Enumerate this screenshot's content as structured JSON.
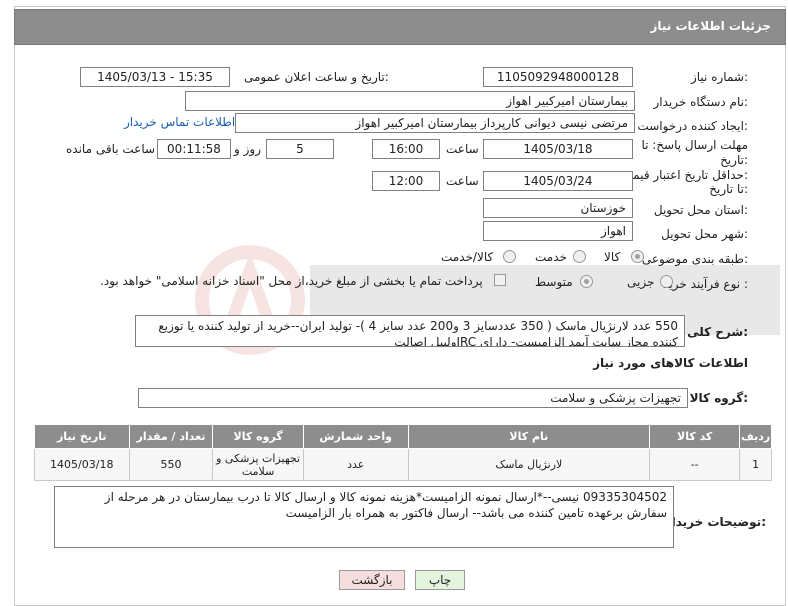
{
  "header": {
    "title": "جزئیات اطلاعات نیاز"
  },
  "fields": {
    "need_number_label": "شماره نیاز:",
    "need_number": "1105092948000128",
    "announce_label": "تاریخ و ساعت اعلان عمومی:",
    "announce_value": "1405/03/13 - 15:35",
    "buyer_org_label": "نام دستگاه خریدار:",
    "buyer_org": "بیمارستان امیرکبیر اهواز",
    "creator_label": "ایجاد کننده درخواست:",
    "creator": "مرتضی نیسی دیوانی کارپرداز بیمارستان امیرکبیر اهواز",
    "contact_link": "اطلاعات تماس خریدار",
    "reply_deadline_label_1": "مهلت ارسال پاسخ: تا",
    "reply_deadline_label_2": "تاریخ:",
    "reply_date": "1405/03/18",
    "time_label": "ساعت",
    "reply_time": "16:00",
    "days_value": "5",
    "days_label": "روز و",
    "remaining_time": "00:11:58",
    "remaining_label": "ساعت باقی مانده",
    "price_validity_label_1": "حداقل تاریخ اعتبار قیمت:",
    "price_validity_label_2": "تا تاریخ:",
    "price_date": "1405/03/24",
    "price_time": "12:00",
    "province_label": "استان محل تحویل:",
    "province": "خوزستان",
    "city_label": "شهر محل تحویل:",
    "city": "اهواز",
    "category_label": "طبقه بندی موضوعی:",
    "cat_goods": "کالا",
    "cat_service": "خدمت",
    "cat_goods_service": "کالا/خدمت",
    "process_label": "نوع فرآیند خرید :",
    "proc_minor": "جزیی",
    "proc_medium": "متوسط",
    "payment_note": "پرداخت تمام یا بخشی از مبلغ خرید،از محل \"اسناد خزانه اسلامی\" خواهد بود."
  },
  "description": {
    "label": "شرح کلی نیاز:",
    "text": "550 عدد لارنژیال ماسک ( 350 عددسایز 3 و200 عدد سایز 4 )- تولید ایران--خرید از تولید کننده یا توزیع کننده مجاز سایت آیمد الزامیست- دارای IRCولیبل اصالت"
  },
  "goods_section": {
    "title": "اطلاعات کالاهای مورد نیاز",
    "group_label": "گروه کالا:",
    "group_value": "تجهیزات پزشکی و سلامت"
  },
  "table": {
    "headers": [
      "ردیف",
      "کد کالا",
      "نام کالا",
      "واحد شمارش",
      "گروه کالا",
      "تعداد / مقدار",
      "تاریخ نیاز"
    ],
    "rows": [
      {
        "row": "1",
        "code": "--",
        "name": "لارنژیال ماسک",
        "unit": "عدد",
        "group": "تجهیزات پزشکی و سلامت",
        "qty": "550",
        "date": "1405/03/18"
      }
    ]
  },
  "buyer_notes": {
    "label": "توضیحات خریدار:",
    "text": "09335304502 نیسی--*ارسال نمونه الزامیست*هزینه نمونه کالا و ارسال کالا تا درب بیمارستان در هر مرحله از سفارش برعهده تامین کننده می باشد-- ارسال فاکتور به همراه بار الزامیست"
  },
  "buttons": {
    "print": "چاپ",
    "back": "بازگشت"
  },
  "colors": {
    "header": "#8d8d8d",
    "link": "#1a5fb4",
    "back_button": "#f6dede",
    "print_button": "#e3f5df"
  }
}
